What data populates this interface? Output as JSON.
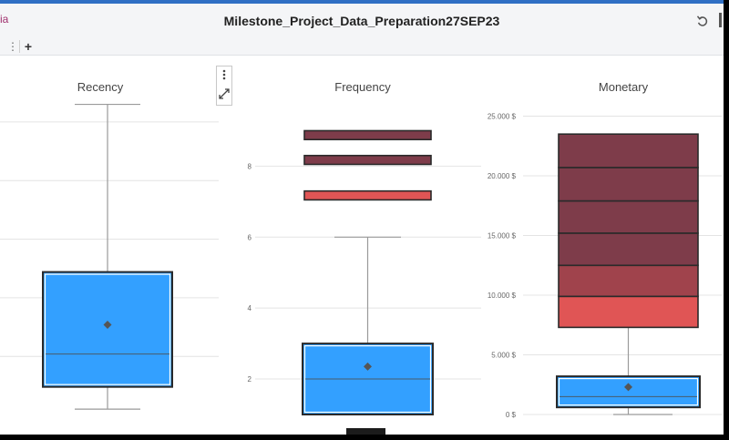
{
  "header": {
    "title": "Milestone_Project_Data_Preparation27SEP23",
    "left_fragment": "ia",
    "menu_glyph": "⋮",
    "add_tab_glyph": "+"
  },
  "colors": {
    "box": "#33a0ff",
    "box_border": "#2a2a2a",
    "whisker": "#9a9a9a",
    "mean_marker": "#555555",
    "grid": "#e4e4e4",
    "outlier_dark": "#7e3c4a",
    "outlier_mid": "#a0434c",
    "outlier_light": "#e05555",
    "tick_text": "#666666",
    "title_text": "#444444"
  },
  "chart_data": [
    {
      "type": "box",
      "title": "Recency",
      "ylim": [
        -5,
        260
      ],
      "y_tick_values": [
        0,
        50,
        100,
        150,
        200,
        250
      ],
      "y_tick_labels": [],
      "box": {
        "whisker_low": 5,
        "q1": 24,
        "median": 52,
        "q3": 122,
        "whisker_high": 265,
        "mean": 77
      },
      "outlier_bins": []
    },
    {
      "type": "box",
      "title": "Frequency",
      "ylim": [
        1,
        9.5
      ],
      "y_tick_values": [
        2,
        4,
        6,
        8
      ],
      "y_tick_labels": [
        "2",
        "4",
        "6",
        "8"
      ],
      "box": {
        "whisker_low": 1,
        "q1": 1,
        "median": 2,
        "q3": 3,
        "whisker_high": 6,
        "mean": 2.35
      },
      "outlier_bins": [
        {
          "low": 7.05,
          "high": 7.3,
          "level": "light"
        },
        {
          "low": 8.05,
          "high": 8.3,
          "level": "dark"
        },
        {
          "low": 8.75,
          "high": 9.0,
          "level": "dark"
        }
      ]
    },
    {
      "type": "box",
      "title": "Monetary",
      "ylim": [
        0,
        25500
      ],
      "y_tick_values": [
        0,
        5000,
        10000,
        15000,
        20000,
        25000
      ],
      "y_tick_labels": [
        "0 $",
        "5.000 $",
        "10.000 $",
        "15.000 $",
        "20.000 $",
        "25.000 $"
      ],
      "box": {
        "whisker_low": 0,
        "q1": 600,
        "median": 1500,
        "q3": 3200,
        "whisker_high": 7300,
        "mean": 2300
      },
      "outlier_bins": [
        {
          "low": 7300,
          "high": 9900,
          "level": "light"
        },
        {
          "low": 9900,
          "high": 12500,
          "level": "mid"
        },
        {
          "low": 12500,
          "high": 15200,
          "level": "dark"
        },
        {
          "low": 15200,
          "high": 17900,
          "level": "dark"
        },
        {
          "low": 17900,
          "high": 20700,
          "level": "dark"
        },
        {
          "low": 20700,
          "high": 23500,
          "level": "dark"
        }
      ]
    }
  ]
}
